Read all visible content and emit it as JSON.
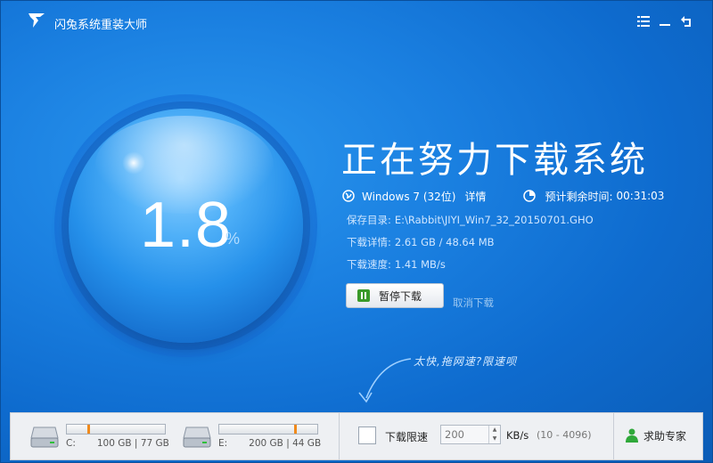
{
  "app": {
    "title": "闪兔系统重装大师"
  },
  "progress": {
    "value": "1.8",
    "unit": "%"
  },
  "status": {
    "headline": "正在努力下载系统",
    "os": "Windows 7 (32位)",
    "details_link": "详情",
    "eta_label": "预计剩余时间:",
    "eta_value": "00:31:03",
    "save_dir_label": "保存目录:",
    "save_dir": "E:\\Rabbit\\JIYI_Win7_32_20150701.GHO",
    "download_detail_label": "下载详情:",
    "download_detail": "2.61 GB / 48.64 MB",
    "speed_label": "下载速度:",
    "speed": "1.41 MB/s"
  },
  "actions": {
    "pause": "暂停下载",
    "cancel": "取消下载"
  },
  "hint": "太快,拖网速?限速呗",
  "drives": [
    {
      "letter": "C:",
      "total": "100 GB",
      "free": "77 GB",
      "used_fraction": 0.23
    },
    {
      "letter": "E:",
      "total": "200 GB",
      "free": "44 GB",
      "used_fraction": 0.78
    }
  ],
  "limit": {
    "label": "下载限速",
    "value": "200",
    "unit": "KB/s",
    "range": "(10 - 4096)"
  },
  "help": {
    "label": "求助专家"
  },
  "colors": {
    "accent": "#1a7fe0",
    "drive_mark": "#f08a1c",
    "pause_green": "#3a9a2a"
  }
}
